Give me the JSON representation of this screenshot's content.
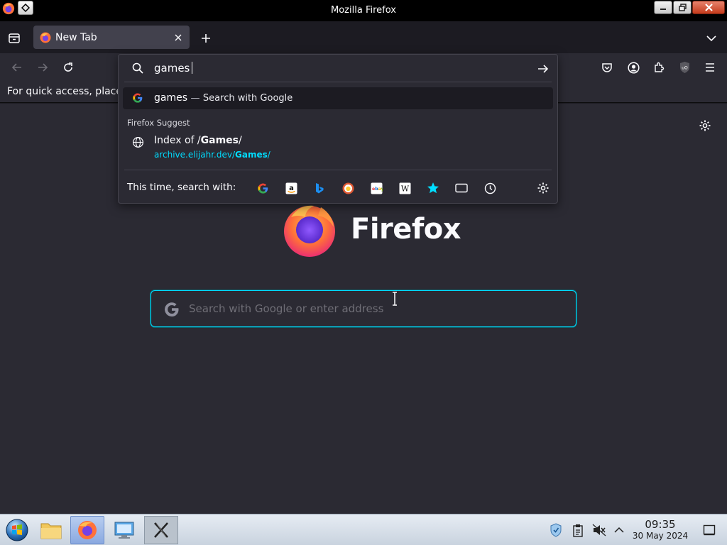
{
  "window": {
    "title": "Mozilla Firefox"
  },
  "tab": {
    "label": "New Tab"
  },
  "bookmarks_bar": {
    "text": "For quick access, place"
  },
  "urlbar": {
    "input_value": "games",
    "top_result": {
      "term": "games",
      "dash": "—",
      "action": "Search with Google"
    },
    "group_label": "Firefox Suggest",
    "suggestion": {
      "title_prefix": "Index of /",
      "title_bold": "Games",
      "title_suffix": "/",
      "url_prefix": "archive.elijahr.dev/",
      "url_bold": "Games",
      "url_suffix": "/"
    },
    "oneoff_label": "This time, search with:",
    "engines": [
      "google-icon",
      "amazon-icon",
      "bing-icon",
      "duckduckgo-icon",
      "ebay-icon",
      "wikipedia-icon",
      "bookmarks-icon",
      "tabs-icon",
      "history-icon"
    ]
  },
  "newtab": {
    "wordmark": "Firefox",
    "search_placeholder": "Search with Google or enter address"
  },
  "taskbar": {
    "time": "09:35",
    "date": "30 May 2024"
  },
  "colors": {
    "accent": "#00ddff",
    "background": "#2b2a33",
    "tab_selected": "#42414d"
  }
}
